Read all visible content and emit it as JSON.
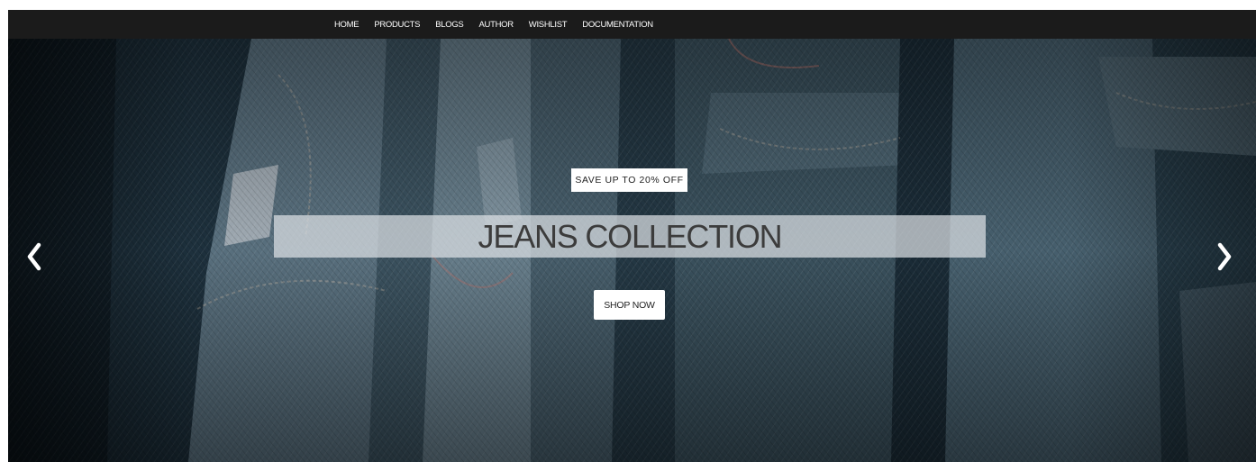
{
  "nav": {
    "items": [
      {
        "label": "HOME"
      },
      {
        "label": "PRODUCTS"
      },
      {
        "label": "BLOGS"
      },
      {
        "label": "AUTHOR"
      },
      {
        "label": "WISHLIST"
      },
      {
        "label": "DOCUMENTATION"
      }
    ]
  },
  "hero": {
    "badge": "SAVE UP TO 20% OFF",
    "title": "JEANS COLLECTION",
    "cta": "SHOP NOW",
    "prev_icon": "chevron-left-icon",
    "next_icon": "chevron-right-icon"
  },
  "colors": {
    "navbar_bg": "#1b1b1b",
    "nav_text": "#ffffff",
    "hero_denim_dark": "#1b2a33",
    "hero_denim_light": "#6f8594",
    "band_bg": "#dce0e4",
    "button_bg": "#ffffff"
  }
}
